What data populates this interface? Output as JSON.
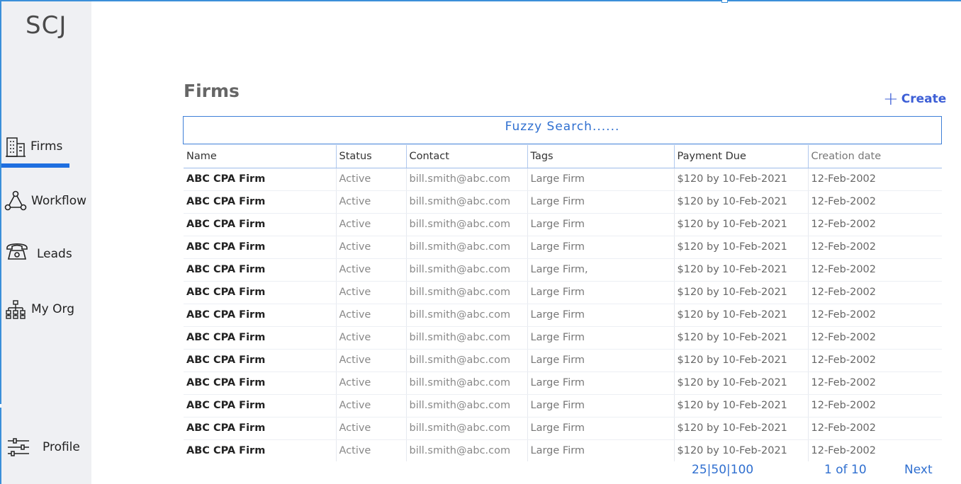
{
  "app": {
    "logo": "SCJ"
  },
  "sidebar": {
    "items": [
      {
        "label": "Firms",
        "icon": "building-icon",
        "active": true
      },
      {
        "label": "Workflow",
        "icon": "workflow-icon"
      },
      {
        "label": "Leads",
        "icon": "phone-icon"
      },
      {
        "label": "My Org",
        "icon": "org-chart-icon"
      },
      {
        "label": "Profile",
        "icon": "sliders-icon"
      }
    ]
  },
  "page": {
    "title": "Firms",
    "create_label": "Create"
  },
  "search": {
    "placeholder": "Fuzzy Search......"
  },
  "table": {
    "columns": [
      "Name",
      "Status",
      "Contact",
      "Tags",
      "Payment Due",
      "Creation date"
    ],
    "rows": [
      [
        "ABC CPA Firm",
        "Active",
        "bill.smith@abc.com",
        "Large Firm",
        "$120 by 10-Feb-2021",
        "12-Feb-2002"
      ],
      [
        "ABC CPA Firm",
        "Active",
        "bill.smith@abc.com",
        "Large Firm",
        "$120 by 10-Feb-2021",
        "12-Feb-2002"
      ],
      [
        "ABC CPA Firm",
        "Active",
        "bill.smith@abc.com",
        "Large Firm",
        "$120 by 10-Feb-2021",
        "12-Feb-2002"
      ],
      [
        "ABC CPA Firm",
        "Active",
        "bill.smith@abc.com",
        "Large Firm",
        "$120 by 10-Feb-2021",
        "12-Feb-2002"
      ],
      [
        "ABC CPA Firm",
        "Active",
        "bill.smith@abc.com",
        "Large Firm,",
        "$120 by 10-Feb-2021",
        "12-Feb-2002"
      ],
      [
        "ABC CPA Firm",
        "Active",
        "bill.smith@abc.com",
        "Large Firm",
        "$120 by 10-Feb-2021",
        "12-Feb-2002"
      ],
      [
        "ABC CPA Firm",
        "Active",
        "bill.smith@abc.com",
        "Large Firm",
        "$120 by 10-Feb-2021",
        "12-Feb-2002"
      ],
      [
        "ABC CPA Firm",
        "Active",
        "bill.smith@abc.com",
        "Large Firm",
        "$120 by 10-Feb-2021",
        "12-Feb-2002"
      ],
      [
        "ABC CPA Firm",
        "Active",
        "bill.smith@abc.com",
        "Large Firm",
        "$120 by 10-Feb-2021",
        "12-Feb-2002"
      ],
      [
        "ABC CPA Firm",
        "Active",
        "bill.smith@abc.com",
        "Large Firm",
        "$120 by 10-Feb-2021",
        "12-Feb-2002"
      ],
      [
        "ABC CPA Firm",
        "Active",
        "bill.smith@abc.com",
        "Large Firm",
        "$120 by 10-Feb-2021",
        "12-Feb-2002"
      ],
      [
        "ABC CPA Firm",
        "Active",
        "bill.smith@abc.com",
        "Large Firm",
        "$120 by 10-Feb-2021",
        "12-Feb-2002"
      ],
      [
        "ABC CPA Firm",
        "Active",
        "bill.smith@abc.com",
        "Large Firm",
        "$120 by 10-Feb-2021",
        "12-Feb-2002"
      ]
    ]
  },
  "pagination": {
    "sizes": [
      "25",
      "50",
      "100"
    ],
    "page_info": "1 of 10",
    "next_label": "Next"
  },
  "colors": {
    "accent": "#1f6fe0",
    "link": "#2f6fd0",
    "sidebar_bg": "#eff0f3",
    "create": "#3d5fd6"
  }
}
